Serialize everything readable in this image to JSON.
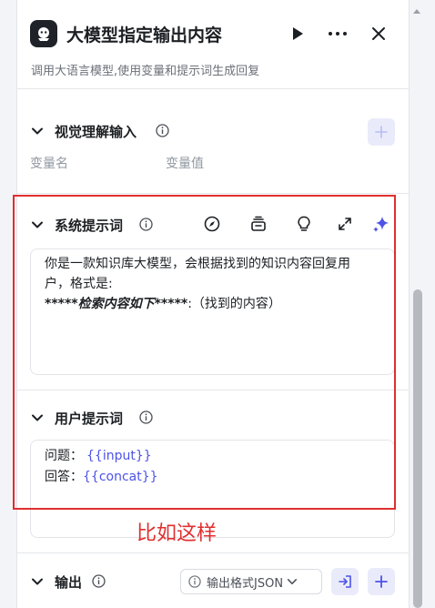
{
  "header": {
    "title": "大模型指定输出内容",
    "subtitle": "调用大语言模型,使用变量和提示词生成回复"
  },
  "vision_input": {
    "title": "视觉理解输入",
    "col_name": "变量名",
    "col_value": "变量值"
  },
  "system_prompt": {
    "title": "系统提示词",
    "line1": "你是一款知识库大模型，会根据找到的知识内容回复用",
    "line2": "户，格式是:",
    "line3_em": "*****检索内容如下*****",
    "line3_rest": ":（找到的内容）"
  },
  "user_prompt": {
    "title": "用户提示词",
    "q_label": "问题：",
    "q_var": "{{input}}",
    "a_label": "回答：",
    "a_var": "{{concat}}"
  },
  "annotation": "比如这样",
  "output": {
    "title": "输出",
    "format_label": "输出格式JSON"
  },
  "colors": {
    "accent": "#4d53e8",
    "annotation_red": "#e02f2f"
  },
  "icons": [
    "bot-icon",
    "play-icon",
    "more-icon",
    "close-icon",
    "chevron-down-icon",
    "info-icon",
    "plus-icon",
    "compass-icon",
    "library-icon",
    "bulb-icon",
    "expand-icon",
    "sparkle-icon",
    "import-icon"
  ]
}
